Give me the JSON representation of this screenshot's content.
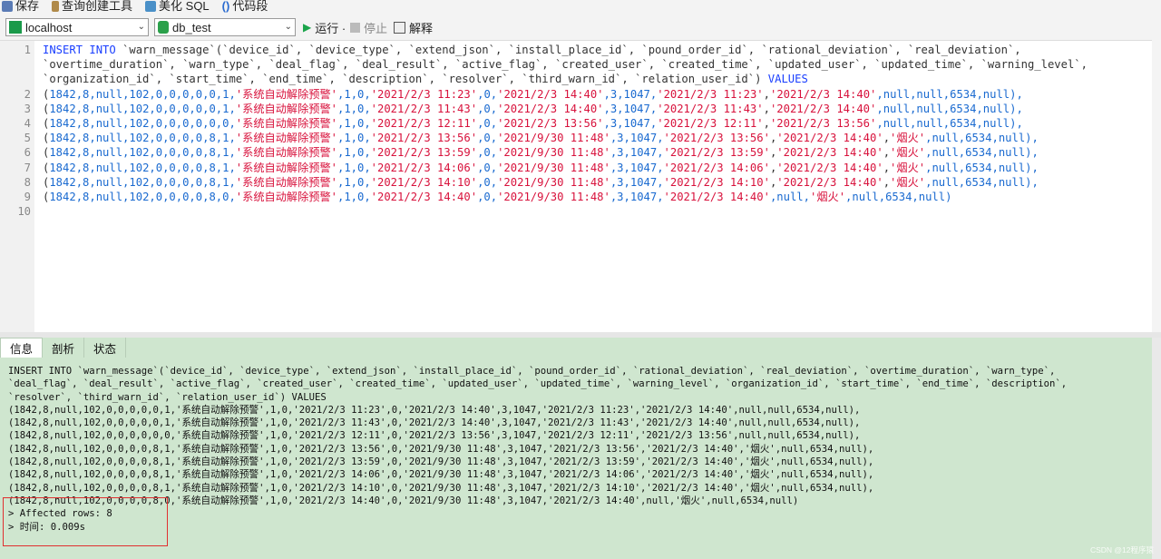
{
  "toolbar": {
    "save": "保存",
    "query_builder": "查询创建工具",
    "beautify_sql": "美化 SQL",
    "code_snippet": "代码段"
  },
  "connection": {
    "host": "localhost",
    "database": "db_test"
  },
  "actions": {
    "run": "运行 ·",
    "stop": "停止",
    "explain": "解释"
  },
  "editor": {
    "lines": [
      {
        "num": "1",
        "tokens": [
          {
            "t": "INSERT INTO",
            "c": "kw"
          },
          {
            "t": " `warn_message`(`device_id`, `device_type`, `extend_json`, `install_place_id`, `pound_order_id`, `rational_deviation`, `real_deviation`,",
            "c": "id"
          }
        ]
      },
      {
        "num": "",
        "tokens": [
          {
            "t": "`overtime_duration`, `warn_type`, `deal_flag`, `deal_result`, `active_flag`, `created_user`, `created_time`, `updated_user`, `updated_time`, `warning_level`,",
            "c": "id"
          }
        ]
      },
      {
        "num": "",
        "tokens": [
          {
            "t": "`organization_id`, `start_time`, `end_time`, `description`, `resolver`, `third_warn_id`, `relation_user_id`) ",
            "c": "id"
          },
          {
            "t": "VALUES",
            "c": "kw"
          }
        ]
      },
      {
        "num": "2",
        "tokens": [
          {
            "t": "(",
            "c": "pu"
          },
          {
            "t": "1842,8,",
            "c": "nul"
          },
          {
            "t": "null",
            "c": "nul"
          },
          {
            "t": ",102,0,0,0,0,0,1,",
            "c": "nul"
          },
          {
            "t": "'系统自动解除预警'",
            "c": "str"
          },
          {
            "t": ",1,0,",
            "c": "nul"
          },
          {
            "t": "'2021/2/3 11:23'",
            "c": "str"
          },
          {
            "t": ",0,",
            "c": "nul"
          },
          {
            "t": "'2021/2/3 14:40'",
            "c": "str"
          },
          {
            "t": ",3,1047,",
            "c": "nul"
          },
          {
            "t": "'2021/2/3 11:23'",
            "c": "str"
          },
          {
            "t": ",",
            "c": "pu"
          },
          {
            "t": "'2021/2/3 14:40'",
            "c": "str"
          },
          {
            "t": ",null,null,6534,null),",
            "c": "nul"
          }
        ]
      },
      {
        "num": "3",
        "tokens": [
          {
            "t": "(",
            "c": "pu"
          },
          {
            "t": "1842,8,null,102,0,0,0,0,0,1,",
            "c": "nul"
          },
          {
            "t": "'系统自动解除预警'",
            "c": "str"
          },
          {
            "t": ",1,0,",
            "c": "nul"
          },
          {
            "t": "'2021/2/3 11:43'",
            "c": "str"
          },
          {
            "t": ",0,",
            "c": "nul"
          },
          {
            "t": "'2021/2/3 14:40'",
            "c": "str"
          },
          {
            "t": ",3,1047,",
            "c": "nul"
          },
          {
            "t": "'2021/2/3 11:43'",
            "c": "str"
          },
          {
            "t": ",",
            "c": "pu"
          },
          {
            "t": "'2021/2/3 14:40'",
            "c": "str"
          },
          {
            "t": ",null,null,6534,null),",
            "c": "nul"
          }
        ]
      },
      {
        "num": "4",
        "tokens": [
          {
            "t": "(",
            "c": "pu"
          },
          {
            "t": "1842,8,null,102,0,0,0,0,0,0,",
            "c": "nul"
          },
          {
            "t": "'系统自动解除预警'",
            "c": "str"
          },
          {
            "t": ",1,0,",
            "c": "nul"
          },
          {
            "t": "'2021/2/3 12:11'",
            "c": "str"
          },
          {
            "t": ",0,",
            "c": "nul"
          },
          {
            "t": "'2021/2/3 13:56'",
            "c": "str"
          },
          {
            "t": ",3,1047,",
            "c": "nul"
          },
          {
            "t": "'2021/2/3 12:11'",
            "c": "str"
          },
          {
            "t": ",",
            "c": "pu"
          },
          {
            "t": "'2021/2/3 13:56'",
            "c": "str"
          },
          {
            "t": ",null,null,6534,null),",
            "c": "nul"
          }
        ]
      },
      {
        "num": "5",
        "tokens": [
          {
            "t": "(",
            "c": "pu"
          },
          {
            "t": "1842,8,null,102,0,0,0,0,8,1,",
            "c": "nul"
          },
          {
            "t": "'系统自动解除预警'",
            "c": "str"
          },
          {
            "t": ",1,0,",
            "c": "nul"
          },
          {
            "t": "'2021/2/3 13:56'",
            "c": "str"
          },
          {
            "t": ",0,",
            "c": "nul"
          },
          {
            "t": "'2021/9/30 11:48'",
            "c": "str"
          },
          {
            "t": ",3,1047,",
            "c": "nul"
          },
          {
            "t": "'2021/2/3 13:56'",
            "c": "str"
          },
          {
            "t": ",",
            "c": "pu"
          },
          {
            "t": "'2021/2/3 14:40'",
            "c": "str"
          },
          {
            "t": ",",
            "c": "pu"
          },
          {
            "t": "'烟火'",
            "c": "str"
          },
          {
            "t": ",null,6534,null),",
            "c": "nul"
          }
        ]
      },
      {
        "num": "6",
        "tokens": [
          {
            "t": "(",
            "c": "pu"
          },
          {
            "t": "1842,8,null,102,0,0,0,0,8,1,",
            "c": "nul"
          },
          {
            "t": "'系统自动解除预警'",
            "c": "str"
          },
          {
            "t": ",1,0,",
            "c": "nul"
          },
          {
            "t": "'2021/2/3 13:59'",
            "c": "str"
          },
          {
            "t": ",0,",
            "c": "nul"
          },
          {
            "t": "'2021/9/30 11:48'",
            "c": "str"
          },
          {
            "t": ",3,1047,",
            "c": "nul"
          },
          {
            "t": "'2021/2/3 13:59'",
            "c": "str"
          },
          {
            "t": ",",
            "c": "pu"
          },
          {
            "t": "'2021/2/3 14:40'",
            "c": "str"
          },
          {
            "t": ",",
            "c": "pu"
          },
          {
            "t": "'烟火'",
            "c": "str"
          },
          {
            "t": ",null,6534,null),",
            "c": "nul"
          }
        ]
      },
      {
        "num": "7",
        "tokens": [
          {
            "t": "(",
            "c": "pu"
          },
          {
            "t": "1842,8,null,102,0,0,0,0,8,1,",
            "c": "nul"
          },
          {
            "t": "'系统自动解除预警'",
            "c": "str"
          },
          {
            "t": ",1,0,",
            "c": "nul"
          },
          {
            "t": "'2021/2/3 14:06'",
            "c": "str"
          },
          {
            "t": ",0,",
            "c": "nul"
          },
          {
            "t": "'2021/9/30 11:48'",
            "c": "str"
          },
          {
            "t": ",3,1047,",
            "c": "nul"
          },
          {
            "t": "'2021/2/3 14:06'",
            "c": "str"
          },
          {
            "t": ",",
            "c": "pu"
          },
          {
            "t": "'2021/2/3 14:40'",
            "c": "str"
          },
          {
            "t": ",",
            "c": "pu"
          },
          {
            "t": "'烟火'",
            "c": "str"
          },
          {
            "t": ",null,6534,null),",
            "c": "nul"
          }
        ]
      },
      {
        "num": "8",
        "tokens": [
          {
            "t": "(",
            "c": "pu"
          },
          {
            "t": "1842,8,null,102,0,0,0,0,8,1,",
            "c": "nul"
          },
          {
            "t": "'系统自动解除预警'",
            "c": "str"
          },
          {
            "t": ",1,0,",
            "c": "nul"
          },
          {
            "t": "'2021/2/3 14:10'",
            "c": "str"
          },
          {
            "t": ",0,",
            "c": "nul"
          },
          {
            "t": "'2021/9/30 11:48'",
            "c": "str"
          },
          {
            "t": ",3,1047,",
            "c": "nul"
          },
          {
            "t": "'2021/2/3 14:10'",
            "c": "str"
          },
          {
            "t": ",",
            "c": "pu"
          },
          {
            "t": "'2021/2/3 14:40'",
            "c": "str"
          },
          {
            "t": ",",
            "c": "pu"
          },
          {
            "t": "'烟火'",
            "c": "str"
          },
          {
            "t": ",null,6534,null),",
            "c": "nul"
          }
        ]
      },
      {
        "num": "9",
        "tokens": [
          {
            "t": "(",
            "c": "pu"
          },
          {
            "t": "1842,8,null,102,0,0,0,0,8,0,",
            "c": "nul"
          },
          {
            "t": "'系统自动解除预警'",
            "c": "str"
          },
          {
            "t": ",1,0,",
            "c": "nul"
          },
          {
            "t": "'2021/2/3 14:40'",
            "c": "str"
          },
          {
            "t": ",0,",
            "c": "nul"
          },
          {
            "t": "'2021/9/30 11:48'",
            "c": "str"
          },
          {
            "t": ",3,1047,",
            "c": "nul"
          },
          {
            "t": "'2021/2/3 14:40'",
            "c": "str"
          },
          {
            "t": ",null,",
            "c": "nul"
          },
          {
            "t": "'烟火'",
            "c": "str"
          },
          {
            "t": ",null,6534,null)",
            "c": "nul"
          }
        ]
      },
      {
        "num": "10",
        "tokens": []
      }
    ]
  },
  "result_tabs": [
    "信息",
    "剖析",
    "状态"
  ],
  "result": {
    "lines": [
      "INSERT INTO `warn_message`(`device_id`, `device_type`, `extend_json`, `install_place_id`, `pound_order_id`, `rational_deviation`, `real_deviation`, `overtime_duration`, `warn_type`,",
      "`deal_flag`, `deal_result`, `active_flag`, `created_user`, `created_time`, `updated_user`, `updated_time`, `warning_level`, `organization_id`, `start_time`, `end_time`, `description`,",
      "`resolver`, `third_warn_id`, `relation_user_id`) VALUES",
      "(1842,8,null,102,0,0,0,0,0,1,'系统自动解除预警',1,0,'2021/2/3 11:23',0,'2021/2/3 14:40',3,1047,'2021/2/3 11:23','2021/2/3 14:40',null,null,6534,null),",
      "(1842,8,null,102,0,0,0,0,0,1,'系统自动解除预警',1,0,'2021/2/3 11:43',0,'2021/2/3 14:40',3,1047,'2021/2/3 11:43','2021/2/3 14:40',null,null,6534,null),",
      "(1842,8,null,102,0,0,0,0,0,0,'系统自动解除预警',1,0,'2021/2/3 12:11',0,'2021/2/3 13:56',3,1047,'2021/2/3 12:11','2021/2/3 13:56',null,null,6534,null),",
      "(1842,8,null,102,0,0,0,0,8,1,'系统自动解除预警',1,0,'2021/2/3 13:56',0,'2021/9/30 11:48',3,1047,'2021/2/3 13:56','2021/2/3 14:40','烟火',null,6534,null),",
      "(1842,8,null,102,0,0,0,0,8,1,'系统自动解除预警',1,0,'2021/2/3 13:59',0,'2021/9/30 11:48',3,1047,'2021/2/3 13:59','2021/2/3 14:40','烟火',null,6534,null),",
      "(1842,8,null,102,0,0,0,0,8,1,'系统自动解除预警',1,0,'2021/2/3 14:06',0,'2021/9/30 11:48',3,1047,'2021/2/3 14:06','2021/2/3 14:40','烟火',null,6534,null),",
      "(1842,8,null,102,0,0,0,0,8,1,'系统自动解除预警',1,0,'2021/2/3 14:10',0,'2021/9/30 11:48',3,1047,'2021/2/3 14:10','2021/2/3 14:40','烟火',null,6534,null),",
      "(1842,8,null,102,0,0,0,0,8,0,'系统自动解除预警',1,0,'2021/2/3 14:40',0,'2021/9/30 11:48',3,1047,'2021/2/3 14:40',null,'烟火',null,6534,null)",
      "> Affected rows: 8",
      "> 时间: 0.009s"
    ]
  },
  "watermark": "CSDN @12程序猿",
  "colors": {
    "keyword": "#1a3fff",
    "string": "#d8123c",
    "literal": "#1a6ad0",
    "result_bg": "#cfe6cf",
    "highlight_border": "#e03030"
  }
}
